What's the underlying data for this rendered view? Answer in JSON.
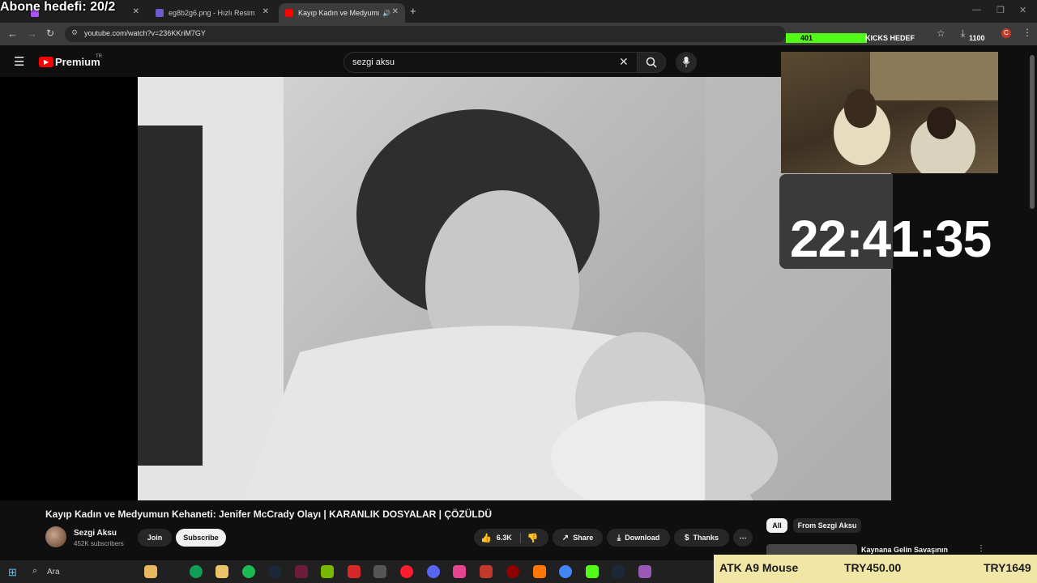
{
  "overlay": {
    "goal_text": "Abone hedefi: 20/2"
  },
  "tabs": [
    {
      "label": "eg8b2g6.png - Hızlı Resim",
      "color": "#6a5acd"
    },
    {
      "label": "Kayıp Kadın ve Medyumun",
      "color": "#ff0000"
    }
  ],
  "browser": {
    "url": "youtube.com/watch?v=236KKriM7GY",
    "new_tab": "+"
  },
  "header": {
    "logo": "Premium",
    "region": "TR",
    "search_value": "sezgi aksu"
  },
  "stream": {
    "kicks_current": "401",
    "kicks_label": "KICKS HEDEF",
    "kicks_goal": "1100",
    "clock": "22:41:35"
  },
  "video": {
    "title": "Kayıp Kadın ve Medyumun Kehaneti: Jenifer McCrady Olayı | KARANLIK DOSYALAR | ÇÖZÜLDÜ",
    "channel": "Sezgi Aksu",
    "subscribers": "452K subscribers",
    "join": "Join",
    "subscribe": "Subscribe",
    "likes": "6.3K",
    "share": "Share",
    "download": "Download",
    "thanks": "Thanks"
  },
  "sidebar": {
    "chips": [
      "All",
      "From Sezgi Aksu"
    ],
    "rec_title": "Kaynana Gelin Savaşının"
  },
  "taskbar": {
    "search": "Ara"
  },
  "ad": {
    "product": "ATK A9 Mouse",
    "price": "TRY450.00",
    "old_price": "TRY1649"
  }
}
